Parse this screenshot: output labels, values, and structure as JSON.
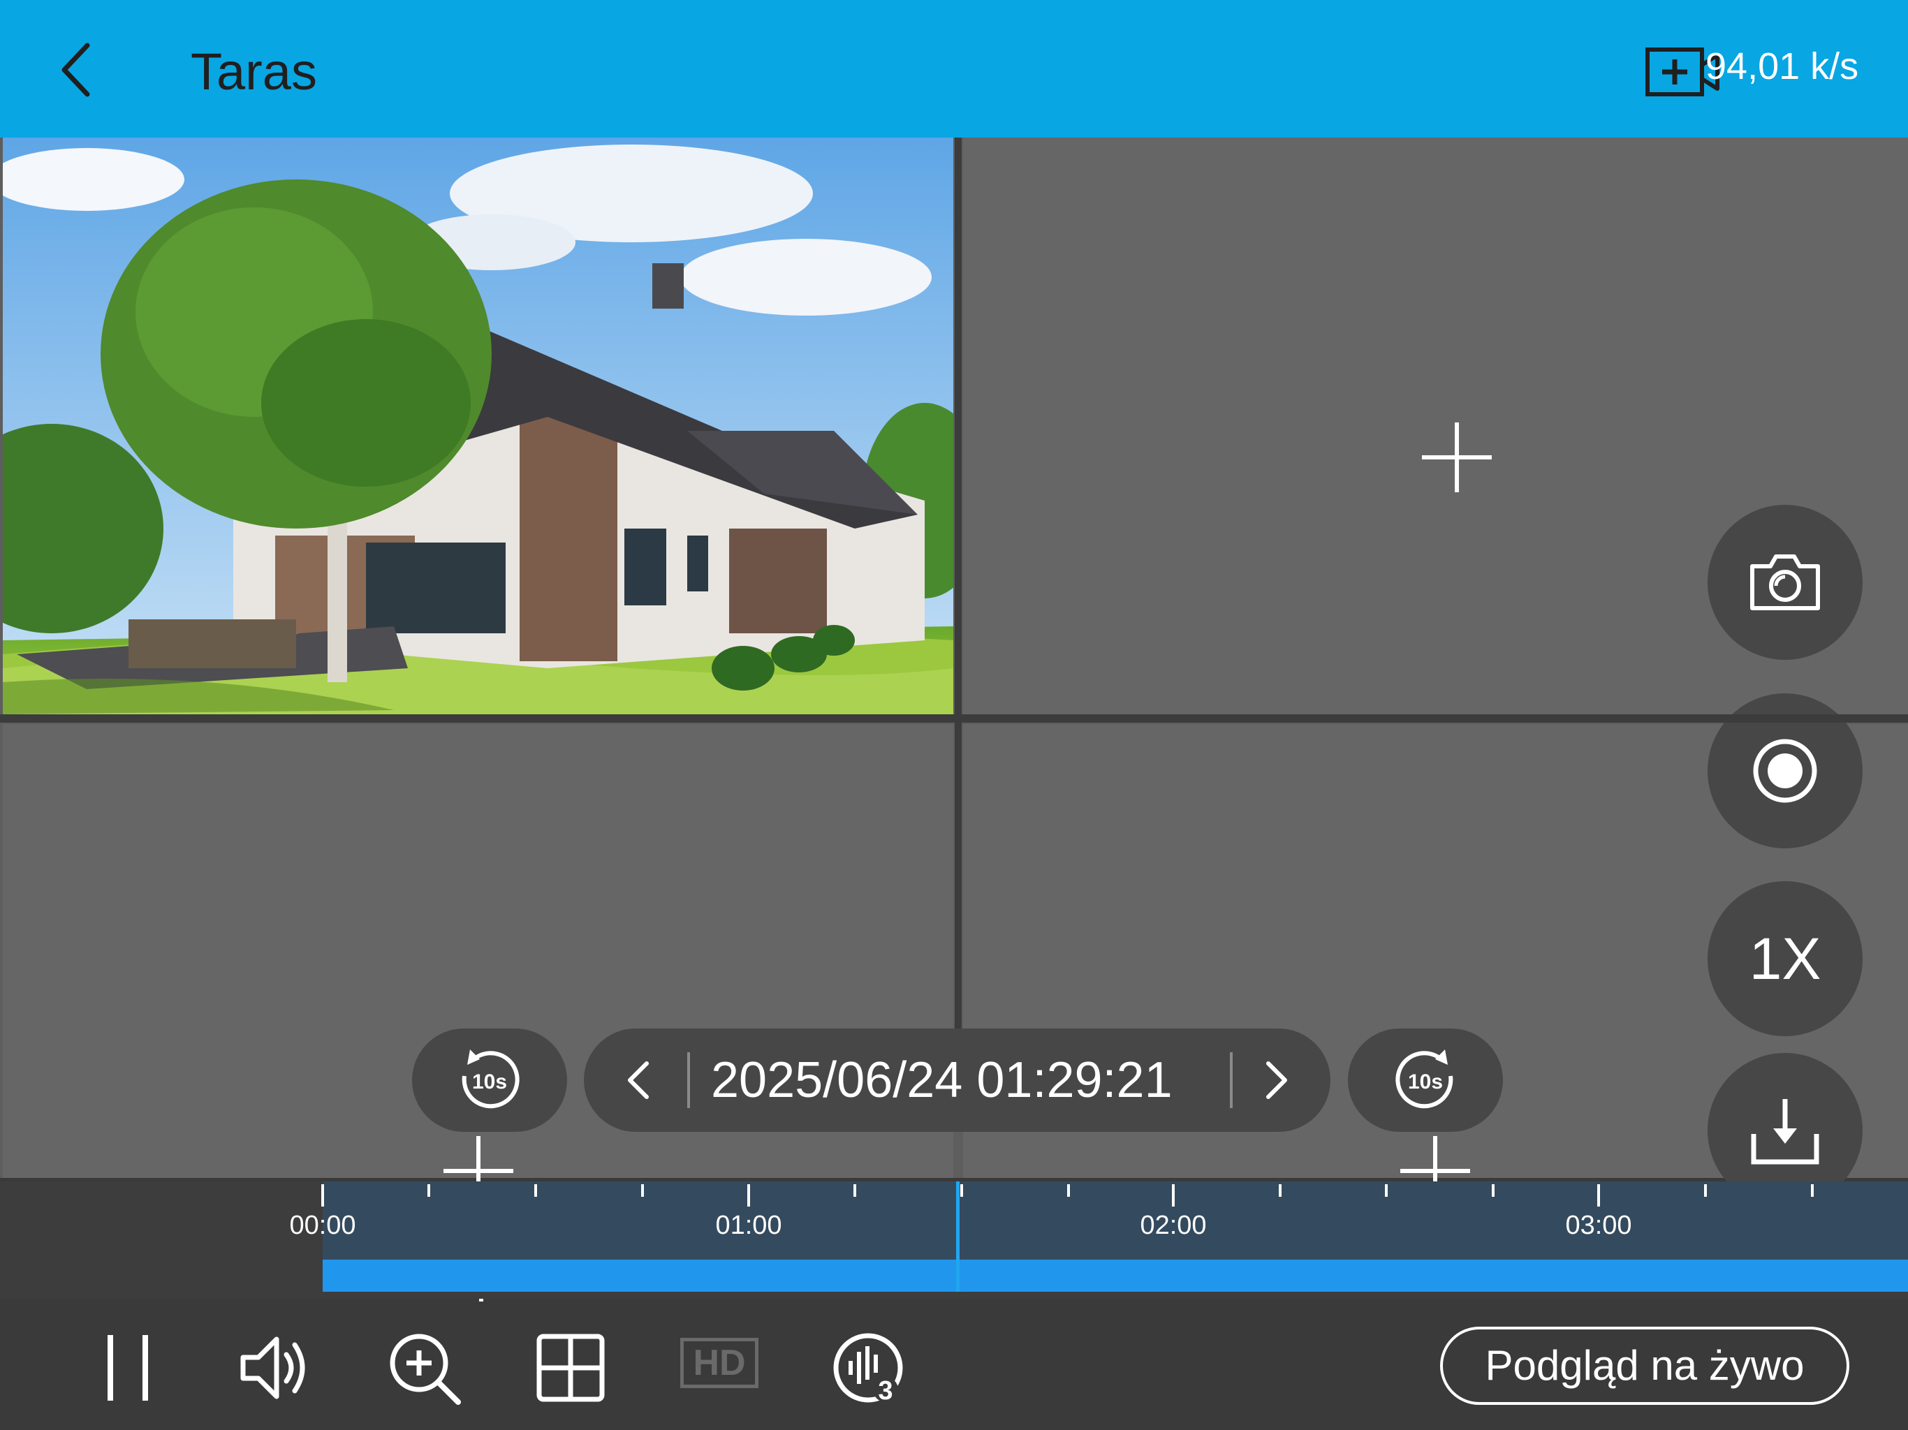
{
  "header": {
    "title": "Taras",
    "bitrate": "94,01 k/s"
  },
  "playback": {
    "datetime": "2025/06/24 01:29:21",
    "speed": "1X"
  },
  "timeline": {
    "tick_labels": [
      "00:00",
      "01:00",
      "02:00",
      "03:00"
    ]
  },
  "toolbar": {
    "hd_label": "HD",
    "live_label": "Podgląd na żywo"
  },
  "icons": {
    "back": "chevron-left-icon",
    "record_add": "add-record-icon",
    "camera": "camera-icon",
    "record": "record-icon",
    "download": "download-icon",
    "rewind": "rewind-10s-icon",
    "forward": "forward-10s-icon",
    "pause": "pause-icon",
    "volume": "volume-icon",
    "zoom": "zoom-in-icon",
    "layout": "grid-layout-icon",
    "hd": "hd-icon",
    "channels": "audio-channels-icon"
  },
  "colors": {
    "header": "#08a6e3",
    "accent_blue": "#2196ed",
    "button_bg": "#474747"
  }
}
